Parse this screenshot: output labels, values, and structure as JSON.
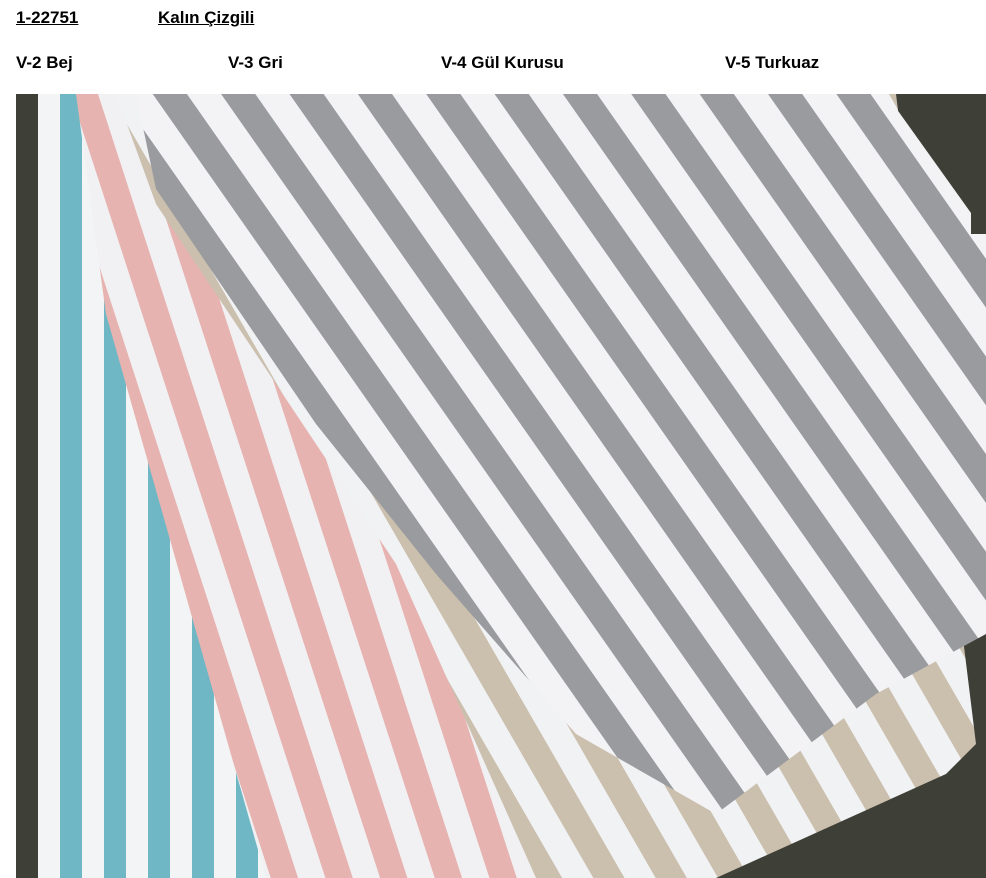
{
  "header": {
    "code": "1-22751",
    "title": "Kalın Çizgili"
  },
  "variants": [
    {
      "label": "V-2 Bej"
    },
    {
      "label": "V-3 Gri"
    },
    {
      "label": "V-4 Gül Kurusu"
    },
    {
      "label": "V-5 Turkuaz"
    }
  ],
  "photo": {
    "colors": {
      "turquoise": "#6fb7c4",
      "pink": "#e7b3b0",
      "beige": "#cbbfae",
      "gray": "#9a9b9f",
      "white": "#f3f3f5",
      "background": "#3e3f36"
    }
  }
}
